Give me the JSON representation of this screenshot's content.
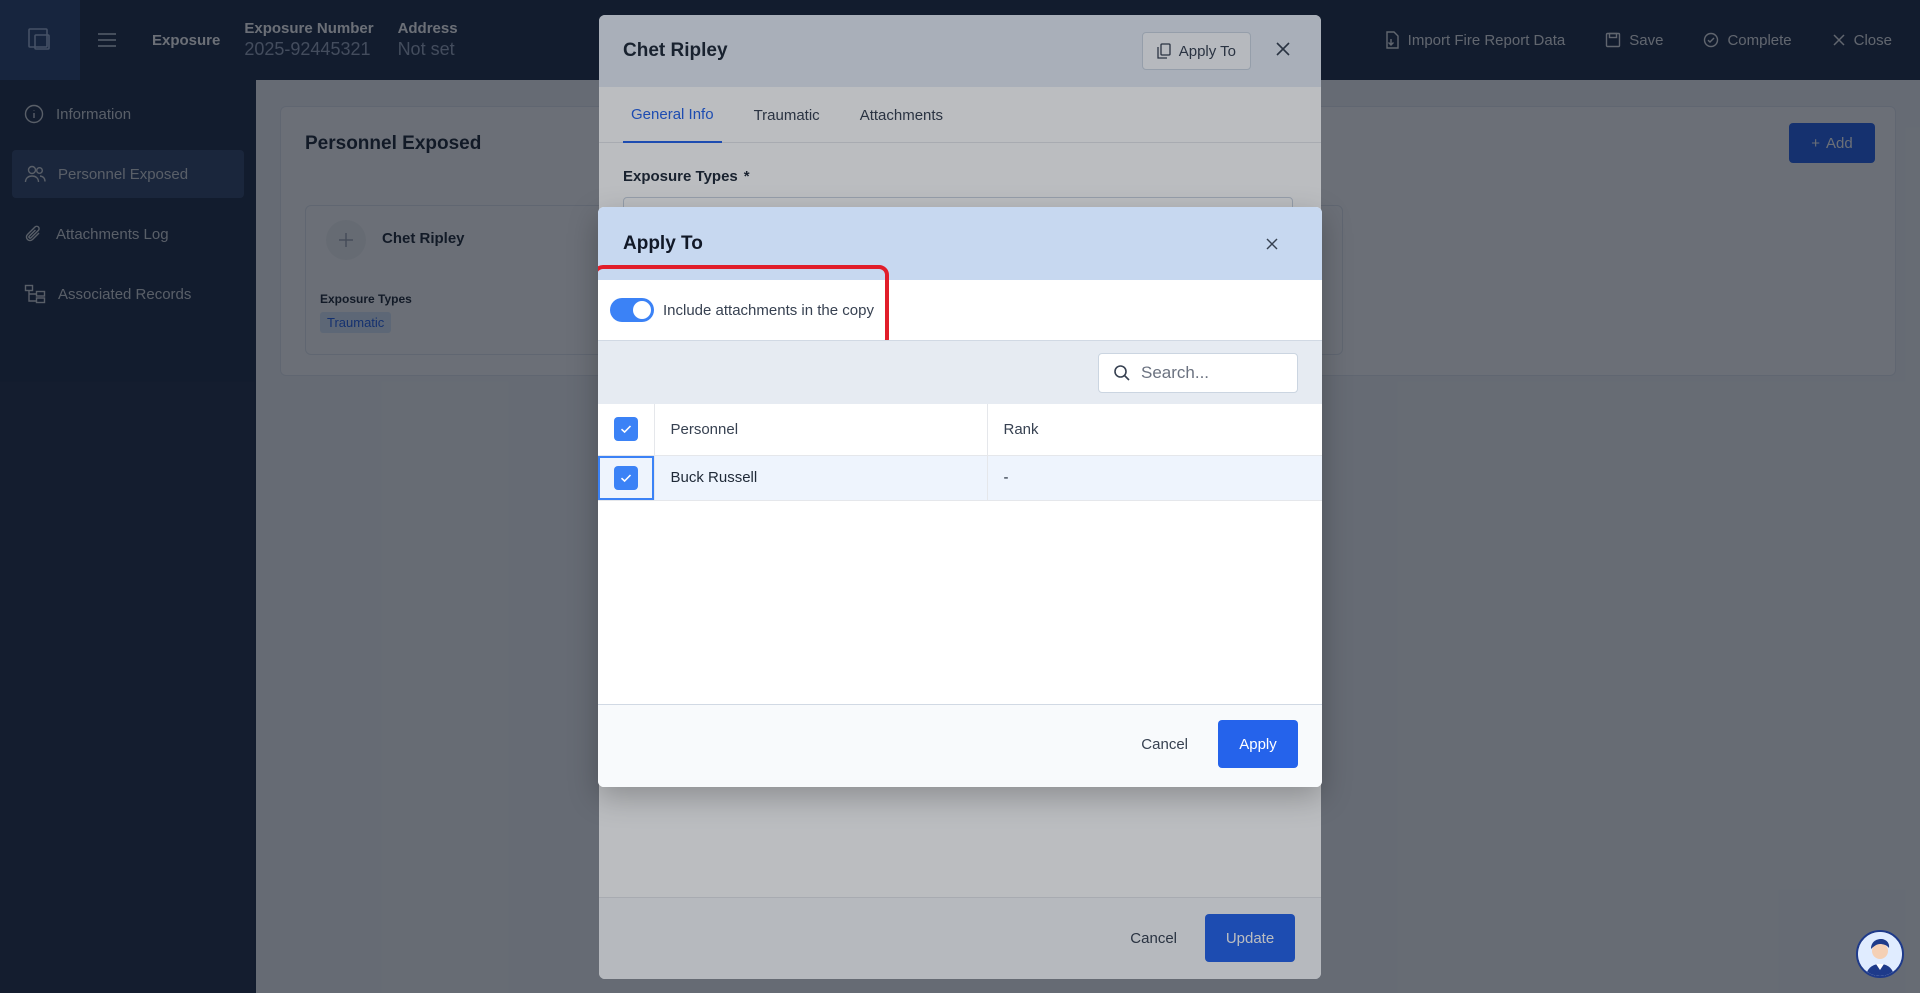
{
  "topbar": {
    "module": "Exposure",
    "exposure_number_label": "Exposure Number",
    "exposure_number": "2025-92445321",
    "address_label": "Address",
    "address": "Not set",
    "actions": {
      "import": "Import Fire Report Data",
      "save": "Save",
      "complete": "Complete",
      "close": "Close"
    }
  },
  "sidebar": {
    "items": [
      {
        "label": "Information",
        "icon": "info-icon"
      },
      {
        "label": "Personnel Exposed",
        "icon": "users-icon"
      },
      {
        "label": "Attachments Log",
        "icon": "paperclip-icon"
      },
      {
        "label": "Associated Records",
        "icon": "tree-icon"
      }
    ]
  },
  "main": {
    "title": "Personnel Exposed",
    "add_label": "Add",
    "card": {
      "name": "Chet Ripley",
      "types_label": "Exposure Types",
      "type_tag": "Traumatic"
    }
  },
  "edit_modal": {
    "title": "Chet Ripley",
    "apply_to_label": "Apply To",
    "tabs": [
      "General Info",
      "Traumatic",
      "Attachments"
    ],
    "field_label": "Exposure Types",
    "required_mark": "*",
    "cancel_label": "Cancel",
    "update_label": "Update"
  },
  "apply_modal": {
    "title": "Apply To",
    "toggle_label": "Include attachments in the copy",
    "toggle_on": true,
    "search_placeholder": "Search...",
    "columns": [
      "Personnel",
      "Rank"
    ],
    "rows": [
      {
        "personnel": "Buck Russell",
        "rank": "-",
        "checked": true
      }
    ],
    "cancel_label": "Cancel",
    "apply_label": "Apply"
  },
  "colors": {
    "accent": "#2563eb",
    "nav_bg": "#1f2d48",
    "highlight": "#e11d2a"
  }
}
